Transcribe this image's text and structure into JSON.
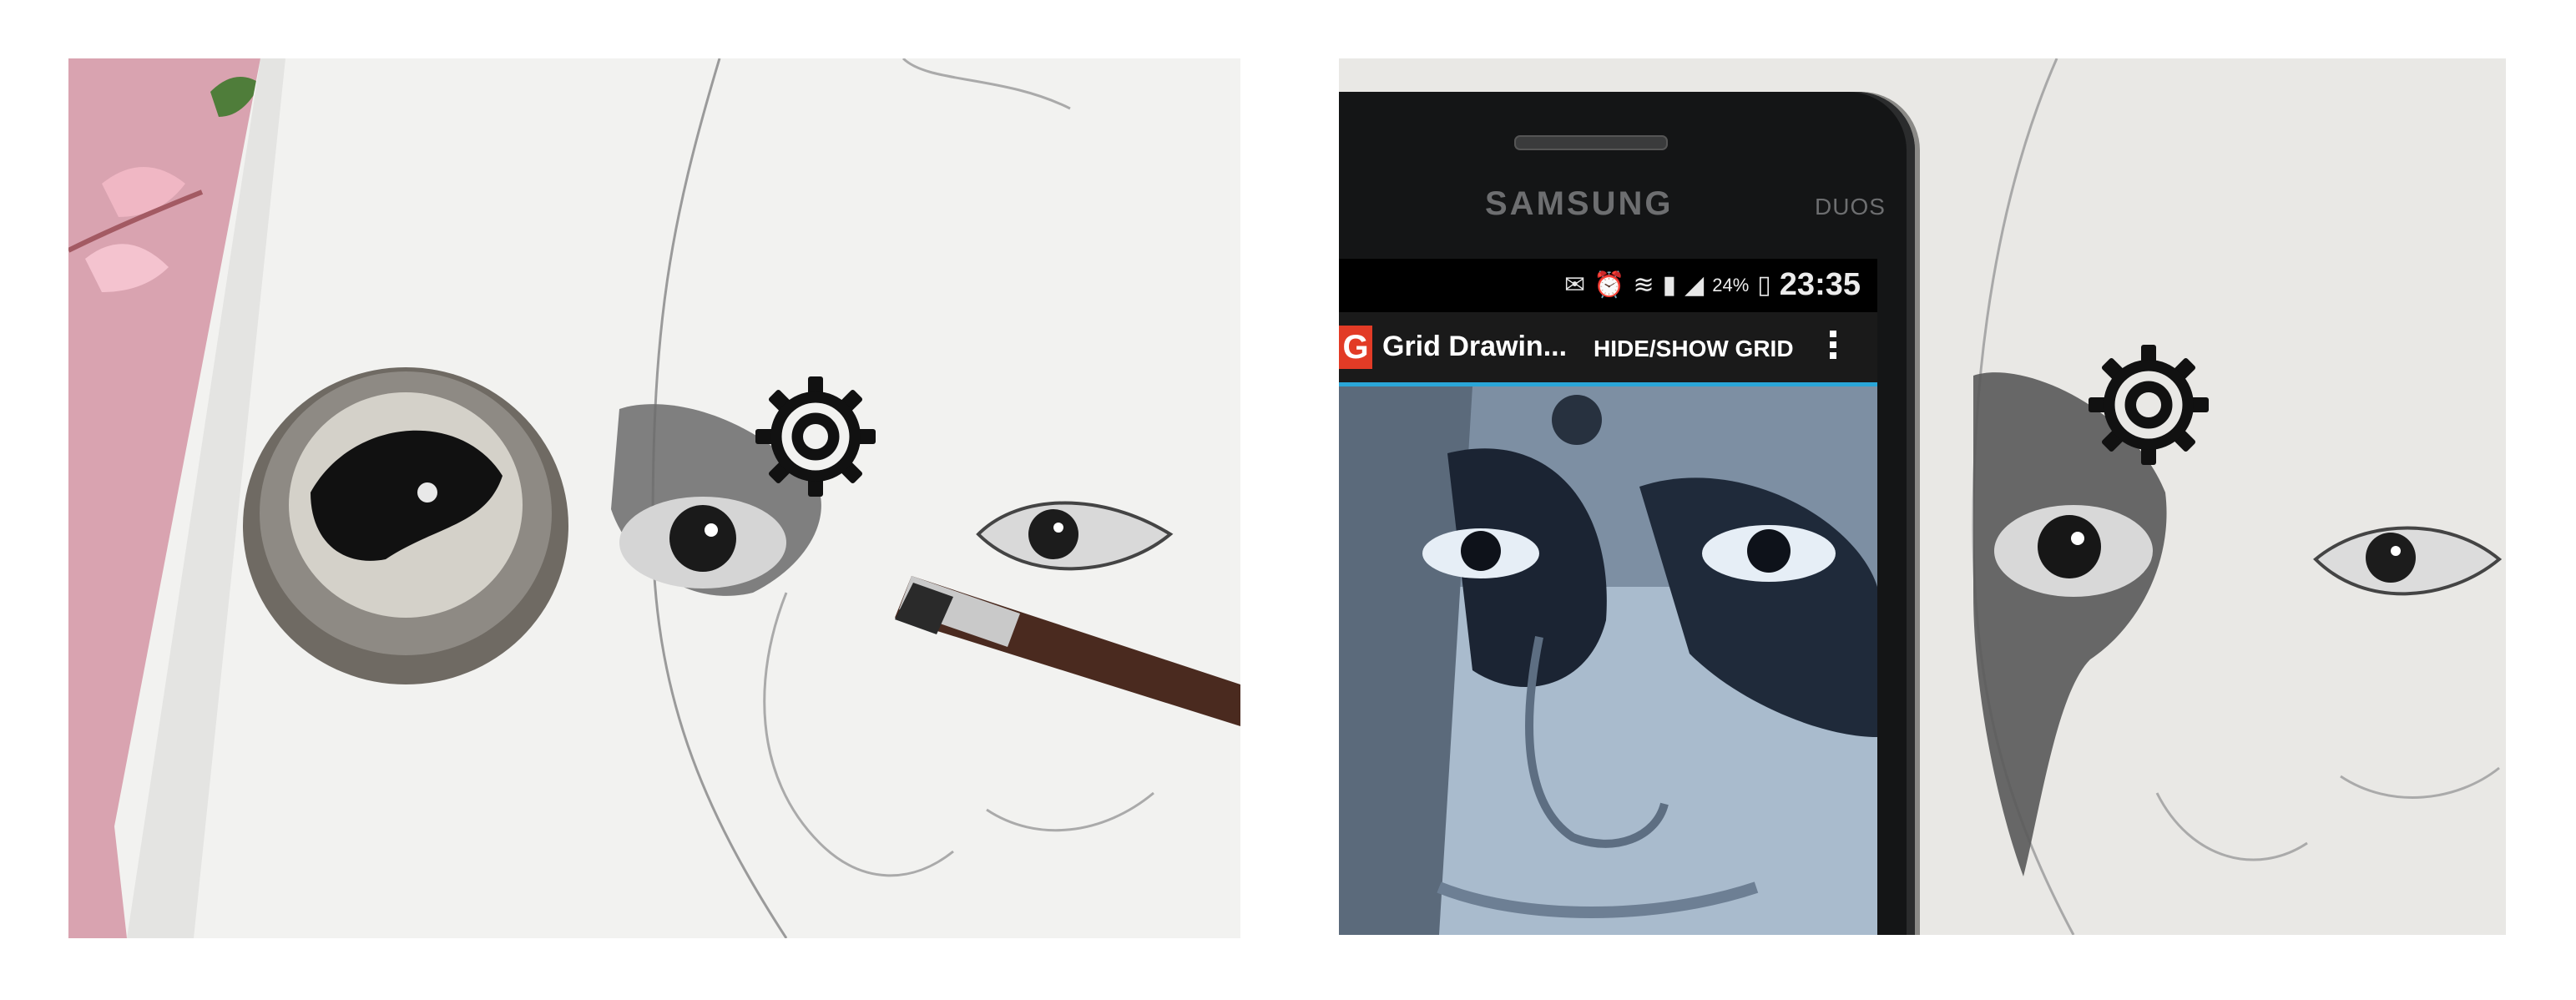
{
  "left_photo": {
    "subject": "powder-jar-brush-eye-sketch",
    "settings_icon": "gear-icon"
  },
  "right_photo": {
    "subject": "phone-reference-eye-sketch",
    "settings_icon": "gear-icon",
    "phone": {
      "brand": "SAMSUNG",
      "model_badge": "DUOS",
      "status_bar": {
        "icons": [
          "mail-icon",
          "alarm-icon",
          "wifi-icon",
          "sd-icon",
          "signal-icon",
          "battery-icon"
        ],
        "battery_percent": "24%",
        "time": "23:35"
      },
      "app": {
        "logo_letter": "G",
        "title": "Grid Drawin...",
        "action": "HIDE/SHOW GRID",
        "overflow_icon": "overflow-menu-icon",
        "accent": "#2aa6d8"
      }
    }
  }
}
